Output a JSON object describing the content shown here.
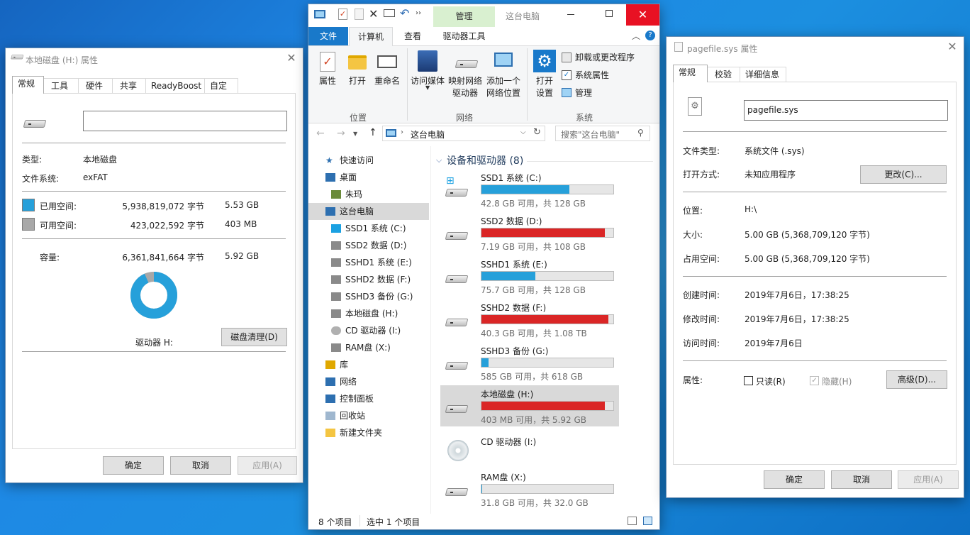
{
  "colors": {
    "accent": "#26a0da",
    "danger": "#da2626",
    "used": "#26a0da",
    "free": "#a8a8a8",
    "ribbon_tab": "#d9f0d0"
  },
  "left": {
    "title": "本地磁盘 (H:) 属性",
    "tabs": [
      "常规",
      "工具",
      "硬件",
      "共享",
      "ReadyBoost",
      "自定义"
    ],
    "name_value": "",
    "type_label": "类型:",
    "type_value": "本地磁盘",
    "fs_label": "文件系统:",
    "fs_value": "exFAT",
    "used_label": "已用空间:",
    "used_bytes": "5,938,819,072 字节",
    "used_gb": "5.53 GB",
    "free_label": "可用空间:",
    "free_bytes": "423,022,592 字节",
    "free_gb": "403 MB",
    "cap_label": "容量:",
    "cap_bytes": "6,361,841,664 字节",
    "cap_gb": "5.92 GB",
    "used_fraction": 0.9335,
    "drive_label": "驱动器 H:",
    "cleanup": "磁盘清理(D)",
    "ok": "确定",
    "cancel": "取消",
    "apply": "应用(A)"
  },
  "explorer": {
    "ctx_tab": "管理",
    "title": "这台电脑",
    "tabs": [
      "文件",
      "计算机",
      "查看",
      "驱动器工具"
    ],
    "ribbon": {
      "props": "属性",
      "open": "打开",
      "rename": "重命名",
      "access_media": "访问媒体",
      "map_drive": "映射网络\n驱动器",
      "add_loc": "添加一个\n网络位置",
      "open_settings": "打开\n设置",
      "uninstall": "卸载或更改程序",
      "sys_props": "系统属性",
      "manage": "管理",
      "grp_location": "位置",
      "grp_network": "网络",
      "grp_system": "系统"
    },
    "address": "这台电脑",
    "search_placeholder": "搜索\"这台电脑\"",
    "nav": [
      {
        "label": "快速访问",
        "icon": "star-icon"
      },
      {
        "label": "桌面",
        "icon": "desktop-icon"
      },
      {
        "label": "朱玛",
        "icon": "user-icon"
      },
      {
        "label": "这台电脑",
        "icon": "computer-icon"
      },
      {
        "label": "SSD1 系统 (C:)",
        "icon": "windows-drive-icon"
      },
      {
        "label": "SSD2 数据 (D:)",
        "icon": "drive-icon"
      },
      {
        "label": "SSHD1 系统 (E:)",
        "icon": "drive-icon"
      },
      {
        "label": "SSHD2 数据 (F:)",
        "icon": "drive-icon"
      },
      {
        "label": "SSHD3 备份 (G:)",
        "icon": "drive-icon"
      },
      {
        "label": "本地磁盘 (H:)",
        "icon": "drive-icon"
      },
      {
        "label": "CD 驱动器 (I:)",
        "icon": "cd-icon"
      },
      {
        "label": "RAM盘 (X:)",
        "icon": "drive-icon"
      },
      {
        "label": "库",
        "icon": "library-icon"
      },
      {
        "label": "网络",
        "icon": "network-icon"
      },
      {
        "label": "控制面板",
        "icon": "control-panel-icon"
      },
      {
        "label": "回收站",
        "icon": "recycle-bin-icon"
      },
      {
        "label": "新建文件夹",
        "icon": "folder-icon"
      }
    ],
    "section": "设备和驱动器 (8)",
    "drives": [
      {
        "name": "SSD1 系统 (C:)",
        "free": "42.8 GB 可用，共 128 GB",
        "used": 0.666,
        "color": "#26a0da",
        "icon": "windows-drive-icon"
      },
      {
        "name": "SSD2 数据 (D:)",
        "free": "7.19 GB 可用，共 108 GB",
        "used": 0.933,
        "color": "#da2626",
        "icon": "drive-icon"
      },
      {
        "name": "SSHD1 系统 (E:)",
        "free": "75.7 GB 可用，共 128 GB",
        "used": 0.409,
        "color": "#26a0da",
        "icon": "drive-icon"
      },
      {
        "name": "SSHD2 数据 (F:)",
        "free": "40.3 GB 可用，共 1.08 TB",
        "used": 0.964,
        "color": "#da2626",
        "icon": "drive-icon"
      },
      {
        "name": "SSHD3 备份 (G:)",
        "free": "585 GB 可用，共 618 GB",
        "used": 0.053,
        "color": "#26a0da",
        "icon": "drive-icon"
      },
      {
        "name": "本地磁盘 (H:)",
        "free": "403 MB 可用，共 5.92 GB",
        "used": 0.933,
        "color": "#da2626",
        "icon": "drive-icon"
      },
      {
        "name": "CD 驱动器 (I:)",
        "free": "",
        "used": null,
        "color": "",
        "icon": "cd-icon"
      },
      {
        "name": "RAM盘 (X:)",
        "free": "31.8 GB 可用，共 32.0 GB",
        "used": 0.006,
        "color": "#26a0da",
        "icon": "drive-icon"
      }
    ],
    "status_count": "8 个项目",
    "status_sel": "选中 1 个项目"
  },
  "right": {
    "title": "pagefile.sys 属性",
    "tabs": [
      "常规",
      "校验",
      "详细信息"
    ],
    "filename": "pagefile.sys",
    "filetype_label": "文件类型:",
    "filetype": "系统文件 (.sys)",
    "openwith_label": "打开方式:",
    "openwith": "未知应用程序",
    "change": "更改(C)...",
    "loc_label": "位置:",
    "loc": "H:\\",
    "size_label": "大小:",
    "size": "5.00 GB (5,368,709,120 字节)",
    "ondisk_label": "占用空间:",
    "ondisk": "5.00 GB (5,368,709,120 字节)",
    "created_label": "创建时间:",
    "created": "2019年7月6日，17:38:25",
    "modified_label": "修改时间:",
    "modified": "2019年7月6日，17:38:25",
    "accessed_label": "访问时间:",
    "accessed": "2019年7月6日",
    "attr_label": "属性:",
    "readonly": "只读(R)",
    "hidden": "隐藏(H)",
    "advanced": "高级(D)...",
    "ok": "确定",
    "cancel": "取消",
    "apply": "应用(A)"
  }
}
